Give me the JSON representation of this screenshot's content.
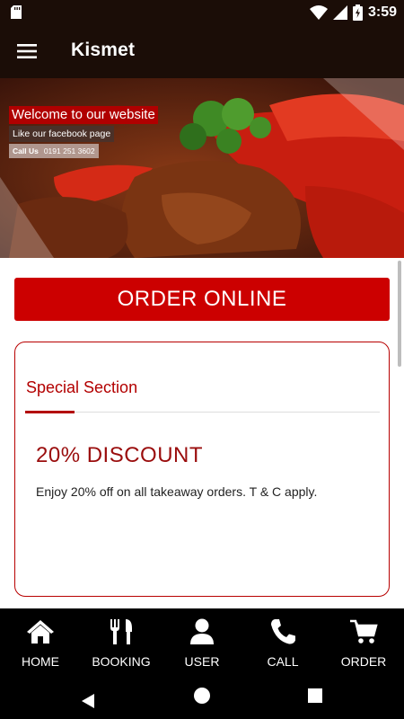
{
  "status_bar": {
    "time": "3:59",
    "icons": [
      "sd-card-icon",
      "wifi-icon",
      "signal-icon",
      "battery-charging-icon"
    ]
  },
  "app_bar": {
    "title": "Kismet",
    "menu_icon": "hamburger-menu-icon"
  },
  "hero": {
    "welcome_text": "Welcome to our website",
    "facebook_text": "Like our facebook page",
    "call_label": "Call Us",
    "phone": "0191 251 3602"
  },
  "order_button": {
    "label": "ORDER ONLINE"
  },
  "special": {
    "section_title": "Special Section",
    "headline": "20% DISCOUNT",
    "description": "Enjoy 20% off on all takeaway orders. T & C apply."
  },
  "bottom_nav": {
    "items": [
      {
        "label": "HOME",
        "icon": "home-icon"
      },
      {
        "label": "BOOKING",
        "icon": "cutlery-icon"
      },
      {
        "label": "USER",
        "icon": "user-icon"
      },
      {
        "label": "CALL",
        "icon": "phone-icon"
      },
      {
        "label": "ORDER",
        "icon": "cart-icon"
      }
    ]
  },
  "system_nav": {
    "icons": [
      "back-icon",
      "home-circle-icon",
      "recents-icon"
    ]
  },
  "colors": {
    "app_bar_bg": "#1b0d07",
    "accent_red": "#cc0000",
    "card_border": "#b80000",
    "discount_text": "#9a0d0d",
    "nav_bg": "#000000"
  }
}
